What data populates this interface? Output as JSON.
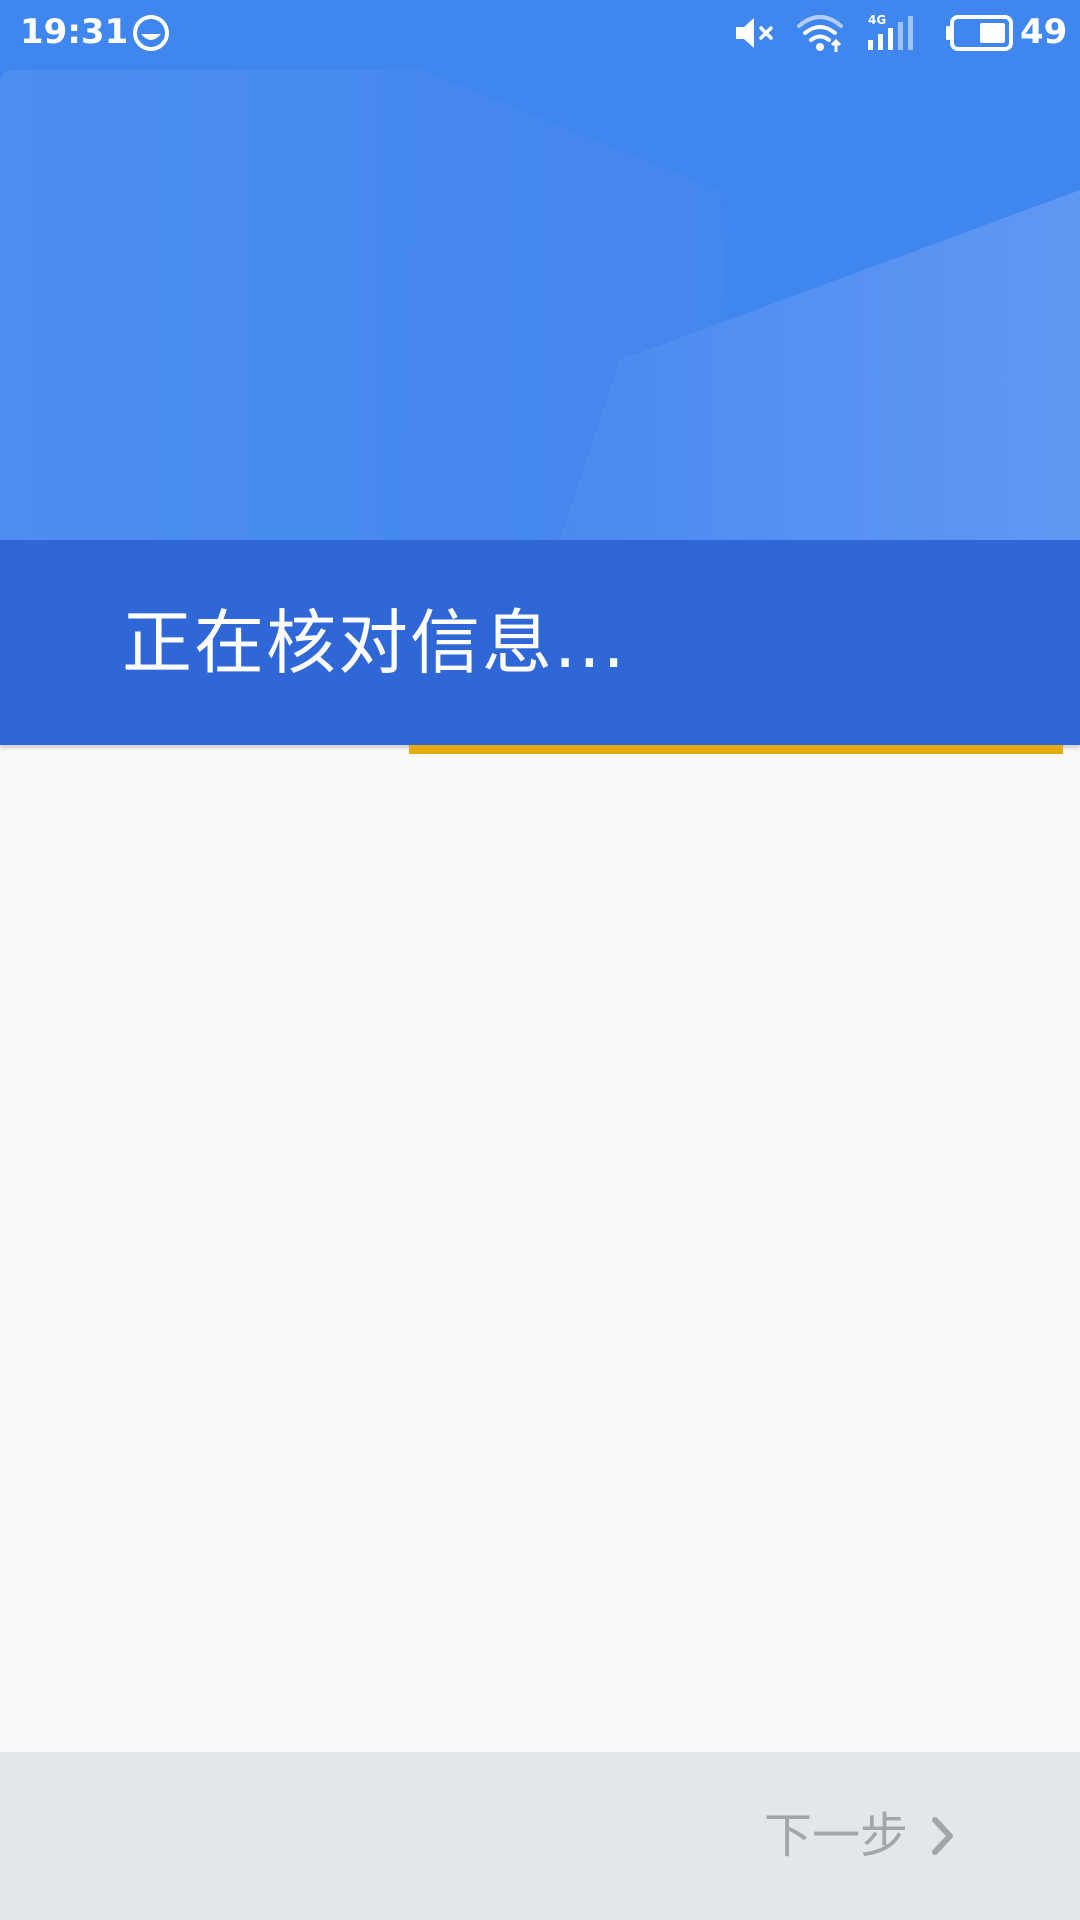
{
  "status_bar": {
    "time": "19:31",
    "battery_level": "49",
    "network_type": "4G",
    "icons": [
      "assistant-icon",
      "mute-icon",
      "wifi-icon",
      "signal-icon",
      "battery-icon"
    ]
  },
  "header": {
    "title": "正在核对信息..."
  },
  "progress": {
    "value_fraction": 0.6
  },
  "footer": {
    "next_label": "下一步",
    "next_icon": "chevron-right-icon"
  },
  "colors": {
    "header_primary": "#3f86ee",
    "title_band": "#2f68d6",
    "progress_accent": "#e2ac10",
    "content_background": "#fafafa",
    "footer_background": "#e4e7e9",
    "disabled_text": "#a2a6a9"
  }
}
